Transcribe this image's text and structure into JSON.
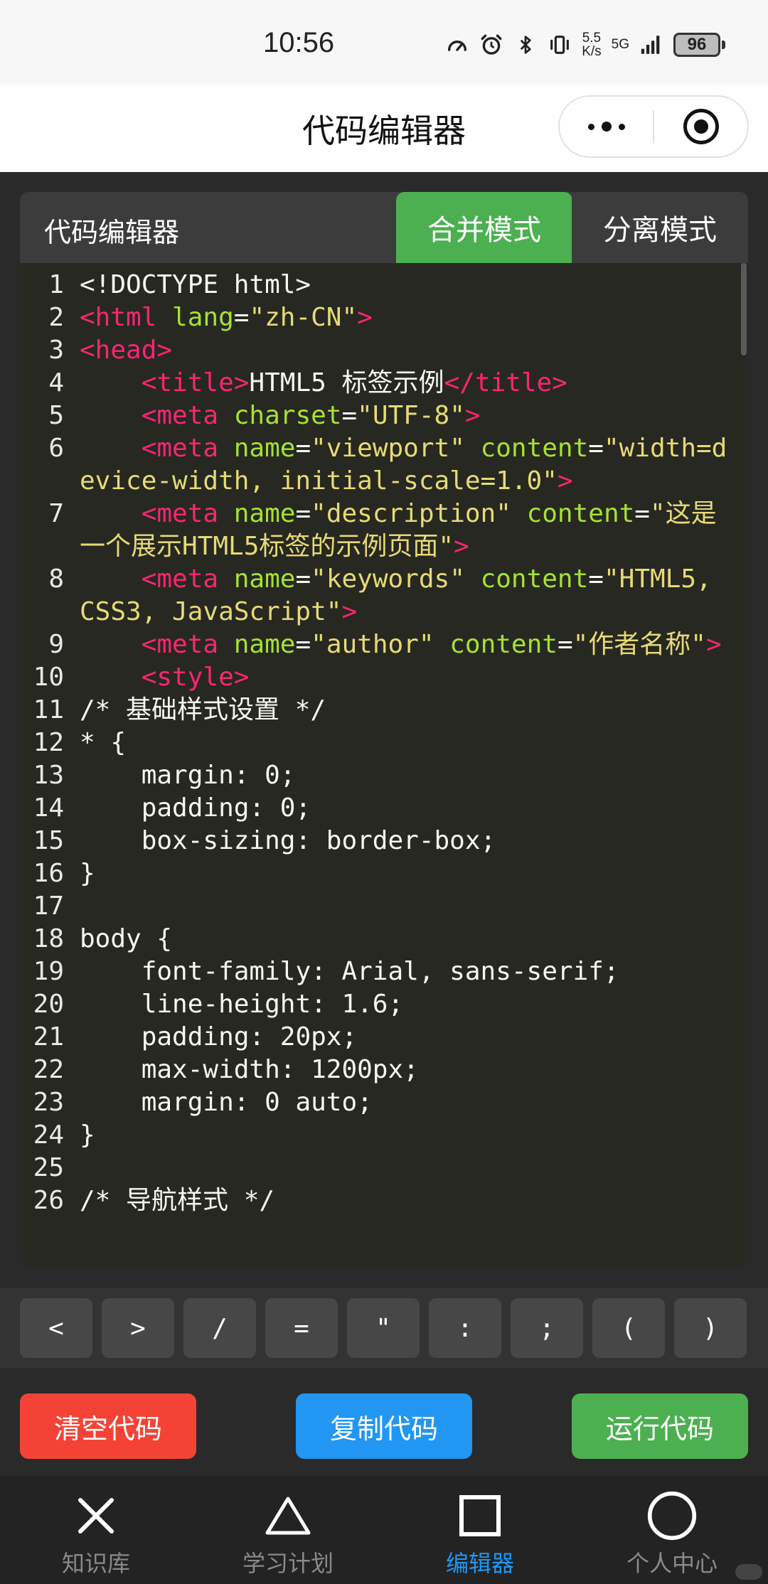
{
  "status_bar": {
    "time": "10:56",
    "net_speed_value": "5.5",
    "net_speed_unit": "K/s",
    "network_type": "5G",
    "battery": "96"
  },
  "titlebar": {
    "title": "代码编辑器"
  },
  "editor": {
    "title": "代码编辑器",
    "mode_merge": "合并模式",
    "mode_split": "分离模式",
    "active_mode": "合并模式",
    "lines": [
      {
        "n": "1",
        "tokens": [
          {
            "c": "p",
            "t": "<!DOCTYPE html>"
          }
        ]
      },
      {
        "n": "2",
        "tokens": [
          {
            "c": "t",
            "t": "<html "
          },
          {
            "c": "a",
            "t": "lang"
          },
          {
            "c": "p",
            "t": "="
          },
          {
            "c": "s",
            "t": "\"zh-CN\""
          },
          {
            "c": "t",
            "t": ">"
          }
        ]
      },
      {
        "n": "3",
        "tokens": [
          {
            "c": "t",
            "t": "<head>"
          }
        ]
      },
      {
        "n": "4",
        "tokens": [
          {
            "c": "p",
            "t": "    "
          },
          {
            "c": "t",
            "t": "<title>"
          },
          {
            "c": "p",
            "t": "HTML5 标签示例"
          },
          {
            "c": "t",
            "t": "</title>"
          }
        ]
      },
      {
        "n": "5",
        "tokens": [
          {
            "c": "p",
            "t": "    "
          },
          {
            "c": "t",
            "t": "<meta "
          },
          {
            "c": "a",
            "t": "charset"
          },
          {
            "c": "p",
            "t": "="
          },
          {
            "c": "s",
            "t": "\"UTF-8\""
          },
          {
            "c": "t",
            "t": ">"
          }
        ]
      },
      {
        "n": "6",
        "tokens": [
          {
            "c": "p",
            "t": "    "
          },
          {
            "c": "t",
            "t": "<meta "
          },
          {
            "c": "a",
            "t": "name"
          },
          {
            "c": "p",
            "t": "="
          },
          {
            "c": "s",
            "t": "\"viewport\" "
          },
          {
            "c": "a",
            "t": "content"
          },
          {
            "c": "p",
            "t": "="
          },
          {
            "c": "s",
            "t": "\"width=device-width, initial-scale=1.0\""
          },
          {
            "c": "t",
            "t": ">"
          }
        ]
      },
      {
        "n": "7",
        "tokens": [
          {
            "c": "p",
            "t": "    "
          },
          {
            "c": "t",
            "t": "<meta "
          },
          {
            "c": "a",
            "t": "name"
          },
          {
            "c": "p",
            "t": "="
          },
          {
            "c": "s",
            "t": "\"description\" "
          },
          {
            "c": "a",
            "t": "content"
          },
          {
            "c": "p",
            "t": "="
          },
          {
            "c": "s",
            "t": "\"这是一个展示HTML5标签的示例页面\""
          },
          {
            "c": "t",
            "t": ">"
          }
        ]
      },
      {
        "n": "8",
        "tokens": [
          {
            "c": "p",
            "t": "    "
          },
          {
            "c": "t",
            "t": "<meta "
          },
          {
            "c": "a",
            "t": "name"
          },
          {
            "c": "p",
            "t": "="
          },
          {
            "c": "s",
            "t": "\"keywords\" "
          },
          {
            "c": "a",
            "t": "content"
          },
          {
            "c": "p",
            "t": "="
          },
          {
            "c": "s",
            "t": "\"HTML5, CSS3, JavaScript\""
          },
          {
            "c": "t",
            "t": ">"
          }
        ]
      },
      {
        "n": "9",
        "tokens": [
          {
            "c": "p",
            "t": "    "
          },
          {
            "c": "t",
            "t": "<meta "
          },
          {
            "c": "a",
            "t": "name"
          },
          {
            "c": "p",
            "t": "="
          },
          {
            "c": "s",
            "t": "\"author\" "
          },
          {
            "c": "a",
            "t": "content"
          },
          {
            "c": "p",
            "t": "="
          },
          {
            "c": "s",
            "t": "\"作者名称\""
          },
          {
            "c": "t",
            "t": ">"
          }
        ]
      },
      {
        "n": "10",
        "tokens": [
          {
            "c": "p",
            "t": "    "
          },
          {
            "c": "t",
            "t": "<style>"
          }
        ]
      },
      {
        "n": "11",
        "tokens": [
          {
            "c": "p",
            "t": "/* 基础样式设置 */"
          }
        ]
      },
      {
        "n": "12",
        "tokens": [
          {
            "c": "p",
            "t": "* {"
          }
        ]
      },
      {
        "n": "13",
        "tokens": [
          {
            "c": "p",
            "t": "    margin: 0;"
          }
        ]
      },
      {
        "n": "14",
        "tokens": [
          {
            "c": "p",
            "t": "    padding: 0;"
          }
        ]
      },
      {
        "n": "15",
        "tokens": [
          {
            "c": "p",
            "t": "    box-sizing: border-box;"
          }
        ]
      },
      {
        "n": "16",
        "tokens": [
          {
            "c": "p",
            "t": "}"
          }
        ]
      },
      {
        "n": "17",
        "tokens": [
          {
            "c": "p",
            "t": ""
          }
        ]
      },
      {
        "n": "18",
        "tokens": [
          {
            "c": "p",
            "t": "body {"
          }
        ]
      },
      {
        "n": "19",
        "tokens": [
          {
            "c": "p",
            "t": "    font-family: Arial, sans-serif;"
          }
        ]
      },
      {
        "n": "20",
        "tokens": [
          {
            "c": "p",
            "t": "    line-height: 1.6;"
          }
        ]
      },
      {
        "n": "21",
        "tokens": [
          {
            "c": "p",
            "t": "    padding: 20px;"
          }
        ]
      },
      {
        "n": "22",
        "tokens": [
          {
            "c": "p",
            "t": "    max-width: 1200px;"
          }
        ]
      },
      {
        "n": "23",
        "tokens": [
          {
            "c": "p",
            "t": "    margin: 0 auto;"
          }
        ]
      },
      {
        "n": "24",
        "tokens": [
          {
            "c": "p",
            "t": "}"
          }
        ]
      },
      {
        "n": "25",
        "tokens": [
          {
            "c": "p",
            "t": ""
          }
        ]
      },
      {
        "n": "26",
        "tokens": [
          {
            "c": "p",
            "t": "/* 导航样式 */"
          }
        ]
      }
    ]
  },
  "keys": [
    "<",
    ">",
    "/",
    "=",
    "\"",
    ":",
    ";",
    "(",
    ")"
  ],
  "actions": {
    "clear": "清空代码",
    "copy": "复制代码",
    "run": "运行代码"
  },
  "nav": [
    {
      "label": "知识库",
      "icon": "cross-icon"
    },
    {
      "label": "学习计划",
      "icon": "triangle-icon"
    },
    {
      "label": "编辑器",
      "icon": "square-icon",
      "active": true
    },
    {
      "label": "个人中心",
      "icon": "circle-icon"
    }
  ],
  "colors": {
    "tag": "#f92672",
    "attr": "#a6e22e",
    "string": "#e6db74",
    "active_green": "#4cb050",
    "clear_red": "#f44336",
    "copy_blue": "#2196f3"
  }
}
